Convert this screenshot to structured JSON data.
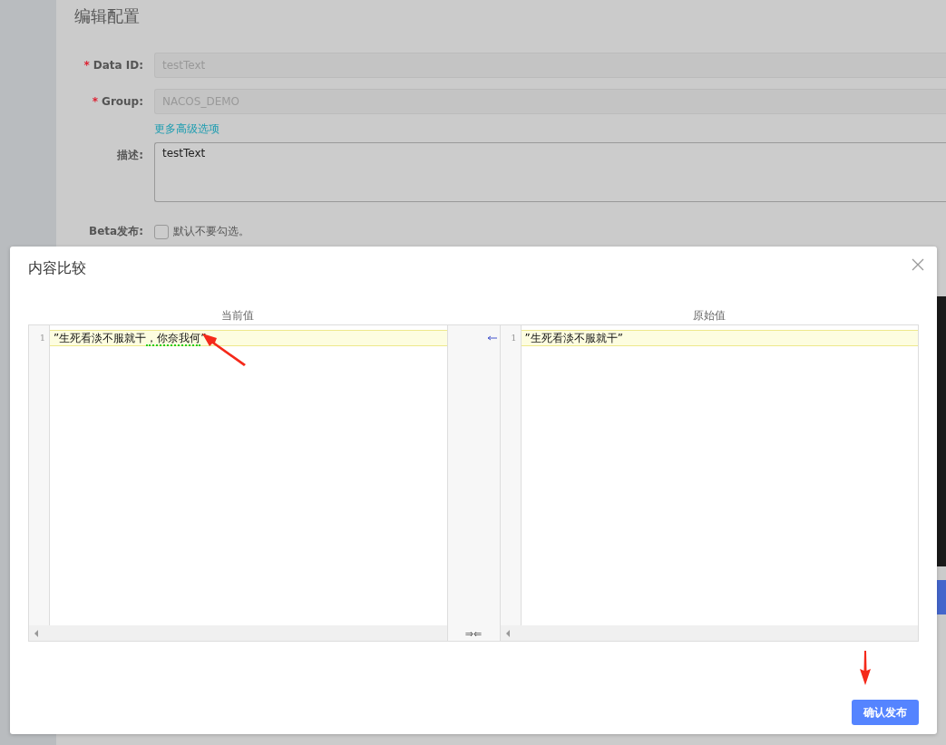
{
  "page": {
    "title": "编辑配置"
  },
  "form": {
    "fields": [
      {
        "label": "Data ID:",
        "required_mark": "*",
        "kind": "input",
        "value": "testText",
        "disabled": true
      },
      {
        "label": "Group:",
        "required_mark": "*",
        "kind": "input",
        "value": "NACOS_DEMO",
        "disabled": true
      }
    ],
    "advanced_link": "更多高级选项",
    "description": {
      "label": "描述:",
      "value": "testText"
    },
    "beta": {
      "label": "Beta发布:",
      "checked": false,
      "hint": "默认不要勾选。"
    }
  },
  "dialog": {
    "title": "内容比较",
    "current": {
      "header": "当前值",
      "lines": [
        {
          "number": "1",
          "segments": [
            {
              "text": "”生死看淡不服就干",
              "changed": false
            },
            {
              "text": "，你奈我何",
              "changed": true
            },
            {
              "text": "”",
              "changed": false
            }
          ]
        }
      ]
    },
    "original": {
      "header": "原始值",
      "lines": [
        {
          "number": "1",
          "segments": [
            {
              "text": "”生死看淡不服就干”",
              "changed": false
            }
          ]
        }
      ]
    },
    "merge_all": "⇒⇐",
    "confirm_button": "确认发布"
  }
}
